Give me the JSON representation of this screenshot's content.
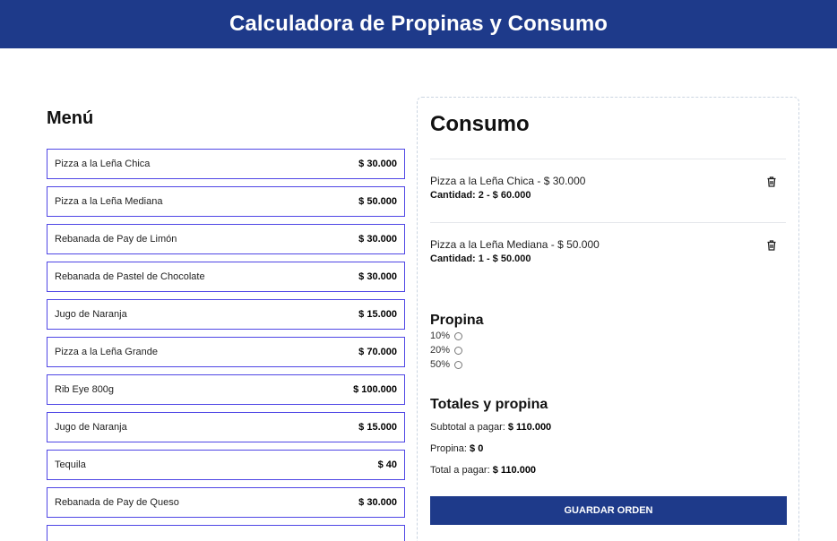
{
  "header": {
    "title": "Calculadora de Propinas y Consumo"
  },
  "menu": {
    "title": "Menú",
    "items": [
      {
        "name": "Pizza a la Leña Chica",
        "price": "$ 30.000"
      },
      {
        "name": "Pizza a la Leña Mediana",
        "price": "$ 50.000"
      },
      {
        "name": "Rebanada de Pay de Limón",
        "price": "$ 30.000"
      },
      {
        "name": "Rebanada de Pastel de Chocolate",
        "price": "$ 30.000"
      },
      {
        "name": "Jugo de Naranja",
        "price": "$ 15.000"
      },
      {
        "name": "Pizza a la Leña Grande",
        "price": "$ 70.000"
      },
      {
        "name": "Rib Eye 800g",
        "price": "$ 100.000"
      },
      {
        "name": "Jugo de Naranja",
        "price": "$ 15.000"
      },
      {
        "name": "Tequila",
        "price": "$ 40"
      },
      {
        "name": "Rebanada de Pay de Queso",
        "price": "$ 30.000"
      },
      {
        "name": "",
        "price": ""
      }
    ]
  },
  "consumo": {
    "title": "Consumo",
    "items": [
      {
        "line": "Pizza a la Leña Chica - $ 30.000",
        "qty": "Cantidad: 2 - $ 60.000"
      },
      {
        "line": "Pizza a la Leña Mediana - $ 50.000",
        "qty": "Cantidad: 1 - $ 50.000"
      }
    ],
    "delete_icon": "trash-icon"
  },
  "propina": {
    "title": "Propina",
    "options": [
      "10%",
      "20%",
      "50%"
    ]
  },
  "totales": {
    "title": "Totales y propina",
    "subtotal_label": "Subtotal a pagar: ",
    "subtotal_value": "$ 110.000",
    "propina_label": "Propina: ",
    "propina_value": "$ 0",
    "total_label": "Total a pagar: ",
    "total_value": "$ 110.000"
  },
  "save_button": "GUARDAR ORDEN",
  "colors": {
    "primary": "#1e3a8a",
    "item_border": "#4f46e5"
  }
}
